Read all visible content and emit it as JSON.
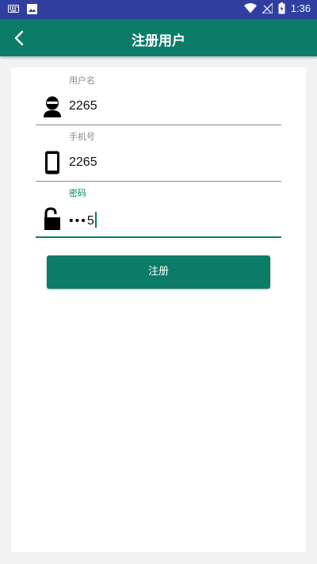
{
  "status_bar": {
    "time": "1:36",
    "icons": [
      "keyboard-icon",
      "image-icon",
      "wifi-icon",
      "signal-icon",
      "battery-icon"
    ]
  },
  "app_bar": {
    "title": "注册用户",
    "back_icon": "chevron-left-icon"
  },
  "form": {
    "username": {
      "label": "用户名",
      "value": "2265",
      "icon": "user-icon"
    },
    "phone": {
      "label": "手机号",
      "value": "2265",
      "icon": "phone-icon"
    },
    "password": {
      "label": "密码",
      "masked": "•••",
      "last_char": "5",
      "icon": "lock-icon"
    }
  },
  "register_button": {
    "label": "注册"
  },
  "colors": {
    "status_bar": "#303f9f",
    "primary": "#0b7c68",
    "background": "#f2f2f2"
  }
}
